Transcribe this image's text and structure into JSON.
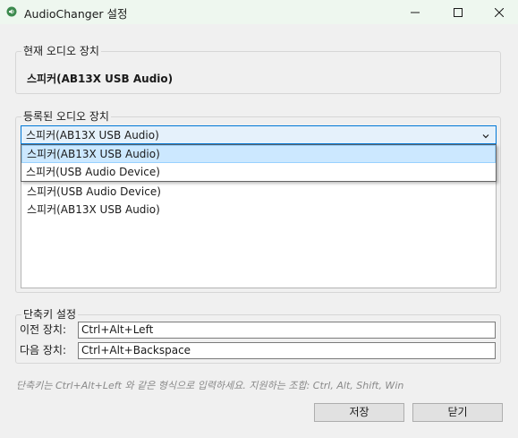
{
  "window": {
    "title": "AudioChanger 설정"
  },
  "current_device": {
    "legend": "현재 오디오 장치",
    "value": "스피커(AB13X USB Audio)"
  },
  "registered_devices": {
    "legend": "등록된 오디오 장치",
    "combo_selected": "스피커(AB13X USB Audio)",
    "dropdown_options": [
      "스피커(AB13X USB Audio)",
      "스피커(USB Audio Device)"
    ],
    "list_items": [
      "스피커(USB Audio Device)",
      "스피커(AB13X USB Audio)"
    ]
  },
  "hotkeys": {
    "legend": "단축키 설정",
    "prev_label": "이전 장치:",
    "prev_value": "Ctrl+Alt+Left",
    "next_label": "다음 장치:",
    "next_value": "Ctrl+Alt+Backspace"
  },
  "hint": "단축키는 Ctrl+Alt+Left 와 같은 형식으로 입력하세요. 지원하는 조합: Ctrl, Alt, Shift, Win",
  "buttons": {
    "save": "저장",
    "close": "닫기"
  },
  "icons": {
    "app": "speaker-icon",
    "minimize": "minimize-icon",
    "maximize": "maximize-icon",
    "close": "close-icon",
    "combo_arrow": "chevron-down-icon"
  },
  "colors": {
    "titlebar": "#eef7ef",
    "accent": "#0078d7",
    "selection": "#cce8ff"
  }
}
